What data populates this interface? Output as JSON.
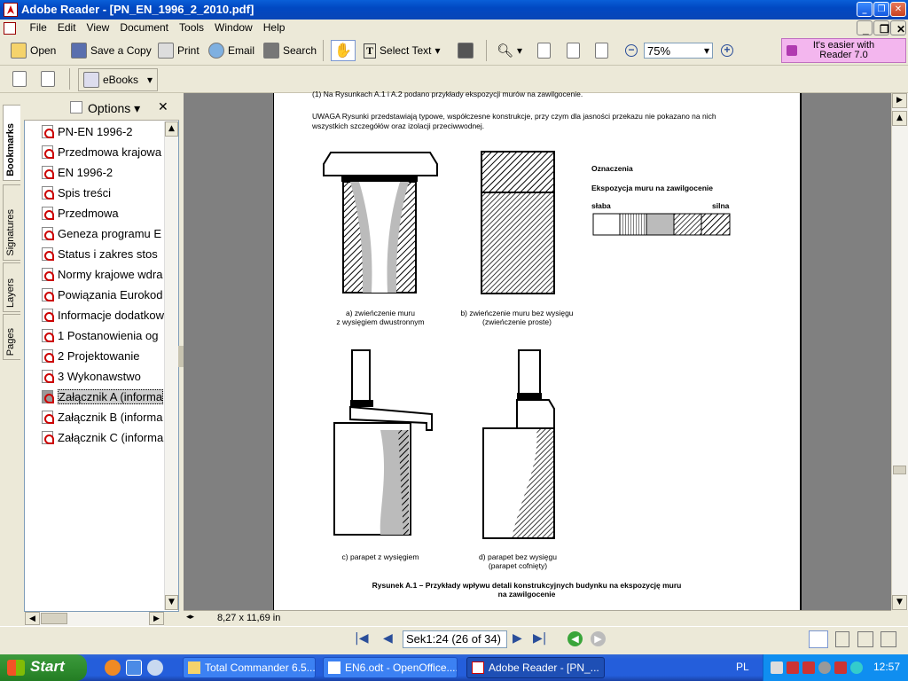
{
  "window": {
    "title": "Adobe Reader - [PN_EN_1996_2_2010.pdf]"
  },
  "menu": [
    "File",
    "Edit",
    "View",
    "Document",
    "Tools",
    "Window",
    "Help"
  ],
  "toolbar": {
    "open": "Open",
    "save_copy": "Save a Copy",
    "print": "Print",
    "email": "Email",
    "search": "Search",
    "select_text": "Select Text",
    "zoom": "75%",
    "ebooks": "eBooks",
    "promo_line1": "It's easier with",
    "promo_line2": "Reader 7.0"
  },
  "sidebar": {
    "tabs": [
      "Bookmarks",
      "Signatures",
      "Layers",
      "Pages"
    ],
    "options": "Options",
    "bookmarks": [
      "PN-EN 1996-2",
      "Przedmowa krajowa",
      "EN 1996-2",
      "Spis treści",
      "Przedmowa",
      "Geneza programu E",
      "Status i zakres stos",
      "Normy krajowe wdra",
      "Powiązania Eurokod",
      "Informacje dodatkow",
      "1 Postanowienia og",
      "2 Projektowanie",
      "3 Wykonawstwo",
      "Załącznik A (informa",
      "Załącznik B (informa",
      "Załącznik C (informa"
    ]
  },
  "page": {
    "cut_line": "(1) Na Rysunkach A.1 i A.2 podano przykłady ekspozycji murów na zawilgocenie.",
    "note_line1": "UWAGA  Rysunki przedstawiają typowe, współczesne konstrukcje, przy czym dla jasności przekazu nie pokazano na nich",
    "note_line2": "wszystkich szczegółów oraz izolacji przeciwwodnej.",
    "legend_title": "Oznaczenia",
    "legend_sub": "Ekspozycja muru na zawilgocenie",
    "legend_weak": "słaba",
    "legend_strong": "silna",
    "cap_a1": "a) zwieńczenie muru",
    "cap_a2": "z wysięgiem dwustronnym",
    "cap_b1": "b) zwieńczenie muru bez wysięgu",
    "cap_b2": "(zwieńczenie proste)",
    "cap_c": "c) parapet z wysięgiem",
    "cap_d1": "d) parapet bez wysięgu",
    "cap_d2": "(parapet cofnięty)",
    "fig_title1": "Rysunek A.1 – Przykłady wpływu detali konstrukcyjnych budynku na ekspozycję muru",
    "fig_title2": "na zawilgocenie"
  },
  "status": {
    "page_size": "8,27 x 11,69 in",
    "page_label": "Sek1:24",
    "page_count": "(26 of 34)"
  },
  "taskbar": {
    "start": "Start",
    "tasks": [
      "Total Commander 6.5...",
      "EN6.odt - OpenOffice....",
      "Adobe Reader - [PN_..."
    ],
    "lang": "PL",
    "clock": "12:57"
  }
}
